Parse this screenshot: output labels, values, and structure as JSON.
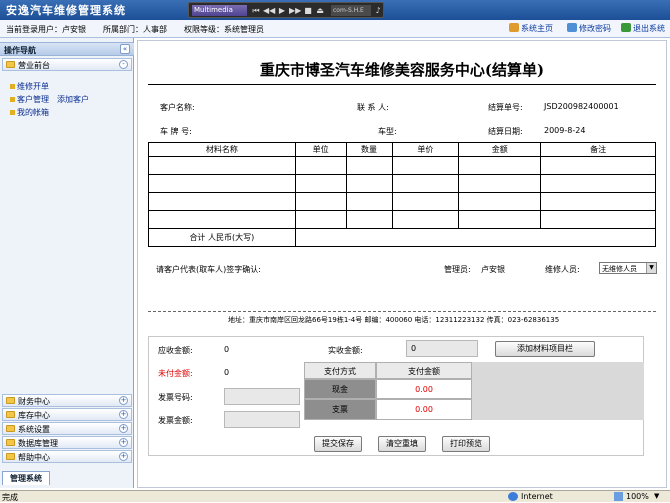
{
  "app": {
    "title": "安逸汽车维修管理系统"
  },
  "player": {
    "display": "Multimedia",
    "track": "com-S.H.E"
  },
  "infobar": {
    "user_label": "当前登录用户：卢安银",
    "dept_label": "所属部门：人事部",
    "level_label": "权限等级：系统管理员"
  },
  "toplinks": {
    "home": "系统主页",
    "password": "修改密码",
    "logout": "退出系统"
  },
  "sidebar": {
    "header": "操作导航",
    "collapse": "«",
    "groups": [
      {
        "label": "营业前台",
        "toggle": "-"
      },
      {
        "label": "财务中心",
        "toggle": "+"
      },
      {
        "label": "库存中心",
        "toggle": "+"
      },
      {
        "label": "系统设置",
        "toggle": "+"
      },
      {
        "label": "数据库管理",
        "toggle": "+"
      },
      {
        "label": "帮助中心",
        "toggle": "+"
      }
    ],
    "links": {
      "repair_order": "维修开单",
      "customer_mgmt": "客户管理",
      "add_customer": "添加客户",
      "my_account": "我的帐箱"
    },
    "tab": "管理系统"
  },
  "document": {
    "title": "重庆市博圣汽车维修美容服务中心(结算单)",
    "customer_name_label": "客户名称:",
    "contact_label": "联 系 人:",
    "order_no_label": "结算单号:",
    "order_no": "JSD200982400001",
    "plate_label": "车 牌 号:",
    "model_label": "车型:",
    "date_label": "结算日期:",
    "date": "2009-8-24",
    "table": {
      "headers": [
        "材料名称",
        "单位",
        "数量",
        "单价",
        "金额",
        "备注"
      ],
      "empty_rows": 4,
      "total_label": "合计  人民币(大写)"
    },
    "sign_label": "请客户代表(取车人)签字确认:",
    "manager_label": "管理员:",
    "manager": "卢安银",
    "repairer_label": "维修人员:",
    "repairer_select": "无维修人员",
    "address": "地址：重庆市南岸区回龙路66号19栋1-4号  邮编：400060  电话：12311223132  传真：023-62836135"
  },
  "payment": {
    "receivable_label": "应收金额:",
    "receivable": "0",
    "received_label": "实收金额:",
    "received": "0",
    "add_material": "添加材料项目栏",
    "unpaid_label": "未付金额:",
    "unpaid": "0",
    "method_header": "支付方式",
    "amount_header": "支付金额",
    "cash_label": "现金",
    "cash_amount": "0.00",
    "check_label": "支票",
    "check_amount": "0.00",
    "invoice_no_label": "发票号码:",
    "invoice_amount_label": "发票金额:",
    "submit": "提交保存",
    "clear": "清空重填",
    "print": "打印预览",
    "unpaid_color": "#e00000",
    "amount_color": "#e00000"
  },
  "statusbar": {
    "left": "完成",
    "zone": "Internet",
    "zoom": "100%"
  }
}
